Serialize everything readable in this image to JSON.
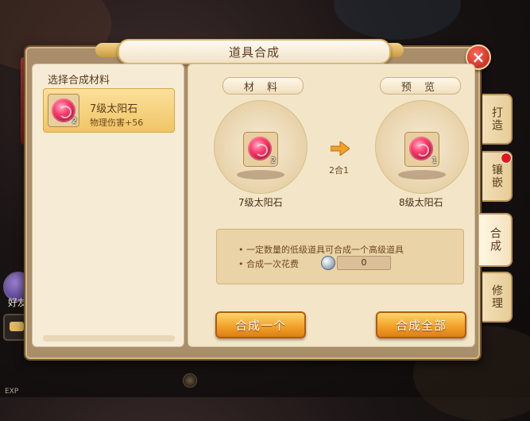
{
  "window": {
    "title": "道具合成",
    "close_label": "×"
  },
  "left_list": {
    "header": "选择合成材料",
    "items": [
      {
        "name": "7级太阳石",
        "stat": "物理伤害+56",
        "count": "2",
        "icon": "sun-stone-icon"
      }
    ]
  },
  "synth": {
    "material_label": "材 料",
    "preview_label": "预 览",
    "material_count": "2",
    "preview_count": "1",
    "ratio": "2合1",
    "material_name": "7级太阳石",
    "preview_name": "8级太阳石",
    "info_line_1": "• 一定数量的低级道具可合成一个高级道具",
    "info_line_2": "• 合成一次花费",
    "cost_value": "0",
    "cost_icon": "silver-coin-icon",
    "btn_one": "合成一个",
    "btn_all": "合成全部"
  },
  "tabs": [
    {
      "label": "打造"
    },
    {
      "label": "镶嵌",
      "has_alert": true
    },
    {
      "label": "合成",
      "active": true
    },
    {
      "label": "修理"
    }
  ],
  "hud": {
    "friend_label": "好友",
    "exp_label": "EXP"
  },
  "colors": {
    "accent_button": "#f3a32a",
    "close_button": "#d8281c",
    "panel_bg": "#f3e6c8",
    "alert_dot": "#e11818"
  }
}
